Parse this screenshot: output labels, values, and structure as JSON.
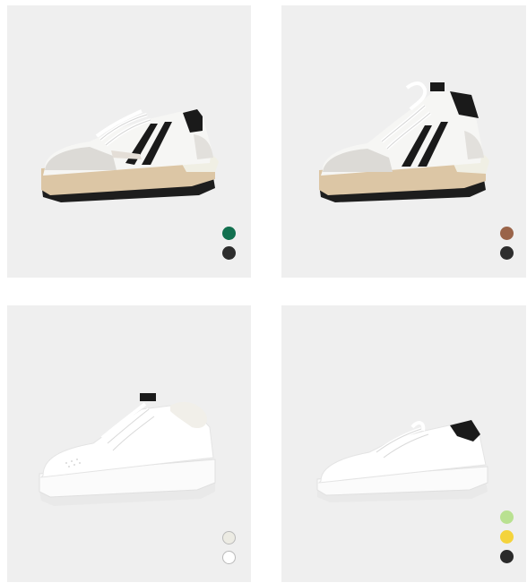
{
  "products": [
    {
      "name": "white-black-stripe-low-top-sneaker",
      "swatches": [
        {
          "name": "green",
          "color": "#12704f"
        },
        {
          "name": "black",
          "color": "#2d2d2d"
        }
      ]
    },
    {
      "name": "white-black-stripe-high-top-sneaker",
      "swatches": [
        {
          "name": "brown",
          "color": "#9a6449"
        },
        {
          "name": "black",
          "color": "#2d2d2d"
        }
      ]
    },
    {
      "name": "white-fleece-lined-platform-sneaker",
      "swatches": [
        {
          "name": "beige",
          "color": "#ecebe3"
        },
        {
          "name": "white",
          "color": "#ffffff"
        }
      ]
    },
    {
      "name": "white-black-heel-low-sneaker",
      "swatches": [
        {
          "name": "lime",
          "color": "#b9e191"
        },
        {
          "name": "yellow",
          "color": "#f4d33c"
        },
        {
          "name": "black",
          "color": "#2a2a2a"
        }
      ]
    }
  ]
}
